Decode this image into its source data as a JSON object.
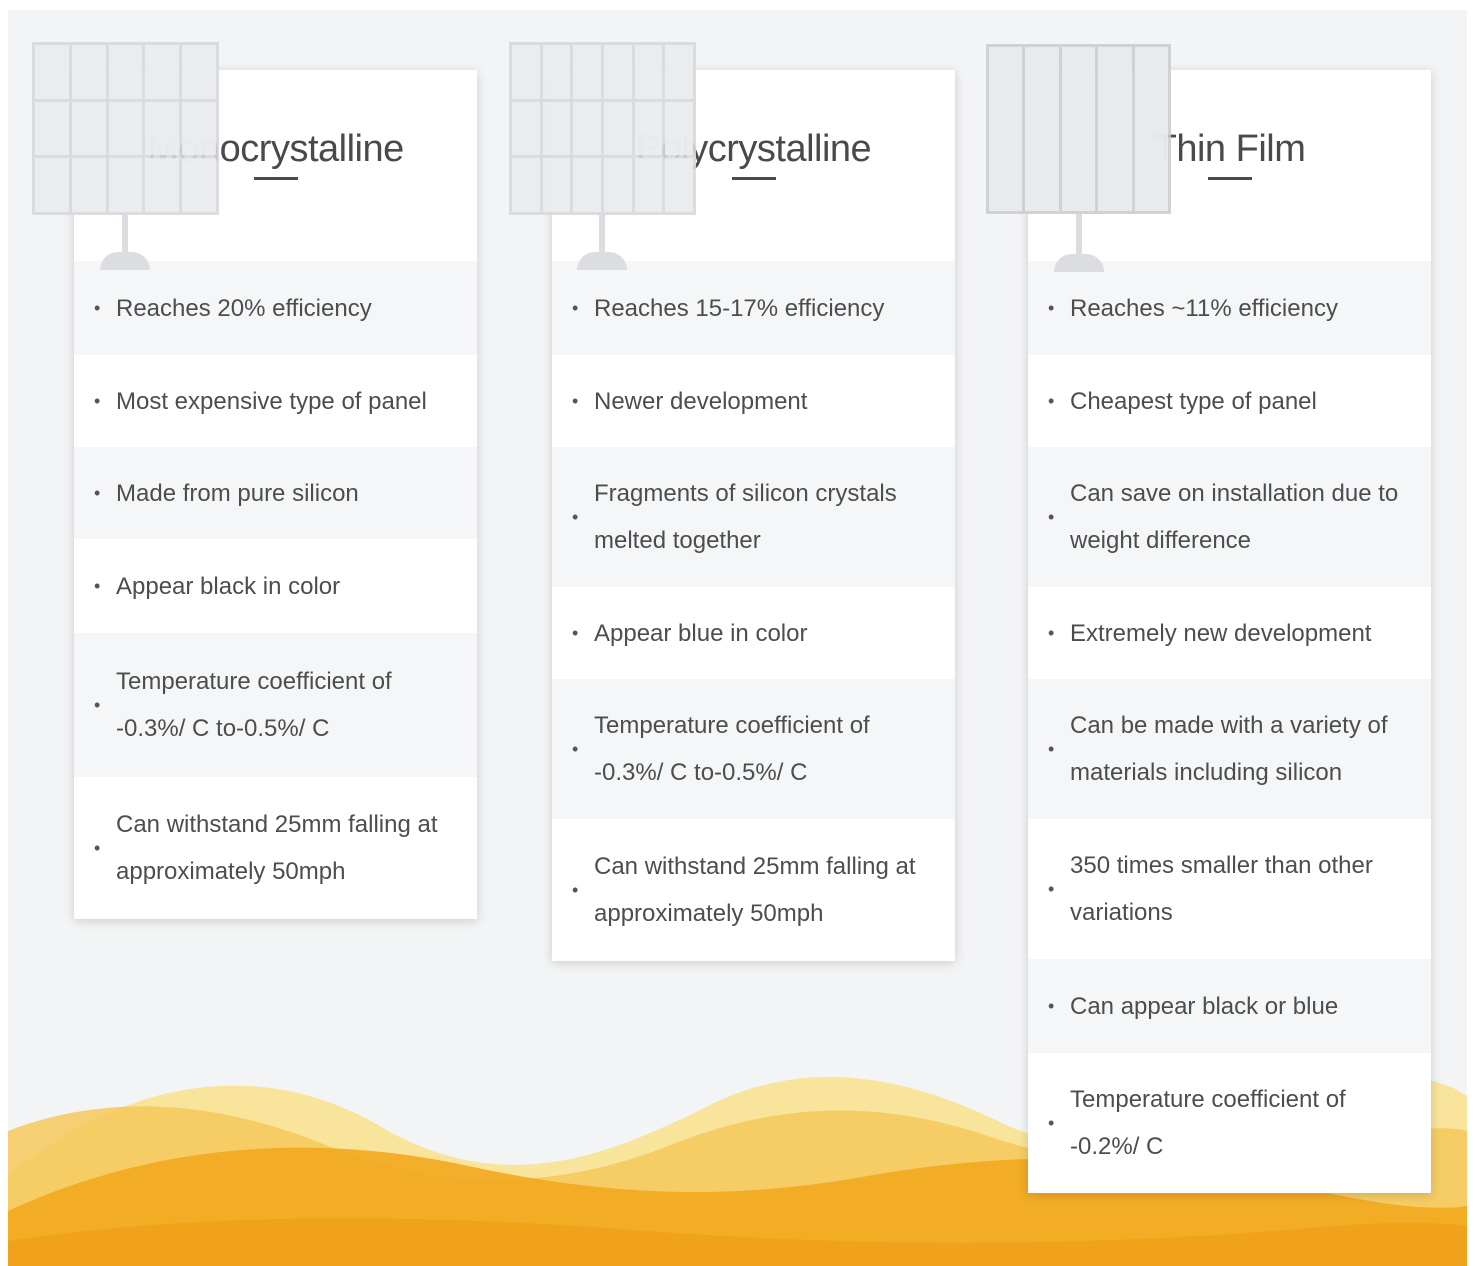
{
  "columns": [
    {
      "title": "Monocrystalline",
      "panel_icon": "monocrystalline-panel-icon",
      "features": [
        "Reaches 20% efficiency",
        "Most expensive type of panel",
        "Made from pure silicon",
        "Appear black in color",
        "Temperature coefficient of -0.3%/ C to-0.5%/ C",
        "Can withstand 25mm falling at approximately 50mph"
      ]
    },
    {
      "title": "Polycrystalline",
      "panel_icon": "polycrystalline-panel-icon",
      "features": [
        "Reaches 15-17% efficiency",
        "Newer development",
        "Fragments of silicon crystals melted together",
        "Appear blue in color",
        "Temperature coefficient of -0.3%/ C to-0.5%/ C",
        "Can withstand 25mm falling at approximately 50mph"
      ]
    },
    {
      "title": "Thin Film",
      "panel_icon": "thin-film-panel-icon",
      "features": [
        "Reaches ~11% efficiency",
        "Cheapest type of panel",
        "Can save on installation due to weight difference",
        "Extremely new development",
        "Can be made with a variety of materials including silicon",
        "350 times smaller than other variations",
        "Can appear black or blue",
        "Temperature coefficient of -0.2%/ C"
      ]
    }
  ],
  "bullet": "•",
  "colors": {
    "background": "#f3f4f5",
    "card": "#ffffff",
    "row_alt": "#f5f6f7",
    "text": "#4d4d4d",
    "wave_light": "#f8e08a",
    "wave_mid": "#f6c85a",
    "wave_deep": "#f2a91f"
  }
}
